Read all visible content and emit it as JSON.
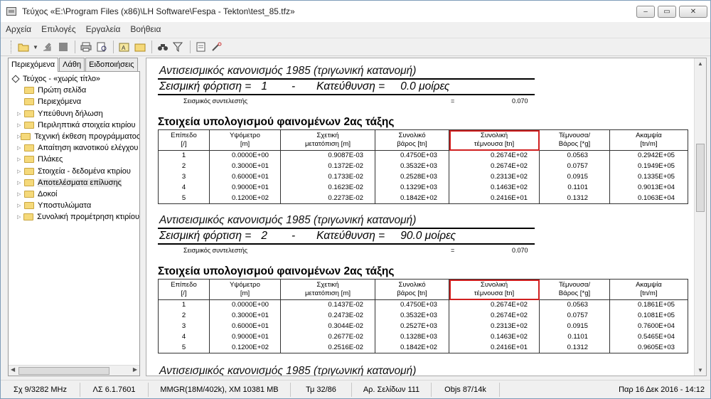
{
  "window": {
    "title": "Τεύχος «E:\\Program Files (x86)\\LH Software\\Fespa - Tekton\\test_85.tfz»",
    "minimize": "–",
    "maximize": "▭",
    "close": "✕"
  },
  "menu": [
    "Αρχεία",
    "Επιλογές",
    "Εργαλεία",
    "Βοήθεια"
  ],
  "left_tabs": [
    "Περιεχόμενα",
    "Λάθη",
    "Ειδοποιήσεις"
  ],
  "tree": {
    "root": "Τεύχος - «χωρίς τίτλο»",
    "items": [
      {
        "label": "Πρώτη σελίδα",
        "arrow": ""
      },
      {
        "label": "Περιεχόμενα",
        "arrow": ""
      },
      {
        "label": "Υπεύθυνη δήλωση",
        "arrow": "▷"
      },
      {
        "label": "Περιληπτικά στοιχεία κτιρίου",
        "arrow": "▷"
      },
      {
        "label": "Τεχνική έκθεση προγράμματος",
        "arrow": "▷"
      },
      {
        "label": "Απαίτηση ικανοτικού ελέγχου",
        "arrow": "▷"
      },
      {
        "label": "Πλάκες",
        "arrow": "▷"
      },
      {
        "label": "Στοιχεία - δεδομένα κτιρίου",
        "arrow": "▷"
      },
      {
        "label": "Αποτελέσματα επίλυσης",
        "arrow": "▷"
      },
      {
        "label": "Δοκοί",
        "arrow": "▷"
      },
      {
        "label": "Υποστυλώματα",
        "arrow": "▷"
      },
      {
        "label": "Συνολική προμέτρηση κτιρίου",
        "arrow": "▷"
      }
    ]
  },
  "document": {
    "norm_title": "Αντισεισμικός κανονισμός 1985 (τριγωνική κατανομή)",
    "coef_label": "Σεισμικός συντελεστής",
    "coef_eq": "=",
    "section_title": "Στοιχεία υπολογισμού φαινομένων 2ας τάξης",
    "headers": [
      [
        "Επίπεδο",
        "[/]"
      ],
      [
        "Υψόμετρο",
        "[m]"
      ],
      [
        "Σχετική",
        "μετατόπιση [m]"
      ],
      [
        "Συνολικό",
        "βάρος [tn]"
      ],
      [
        "Συνολική",
        "τέμνουσα [tn]"
      ],
      [
        "Τέμνουσα/",
        "Βάρος [*g]"
      ],
      [
        "Ακαμψία",
        "[tn/m]"
      ]
    ],
    "blocks": [
      {
        "load_label": "Σεισμική φόρτιση =",
        "load_num": "1",
        "dash": "-",
        "dir_label": "Κατεύθυνση =",
        "dir_value": "0.0 μοίρες",
        "coef_value": "0.070",
        "rows": [
          [
            "1",
            "0.0000E+00",
            "0.9087E-03",
            "0.4750E+03",
            "0.2674E+02",
            "0.0563",
            "0.2942E+05"
          ],
          [
            "2",
            "0.3000E+01",
            "0.1372E-02",
            "0.3532E+03",
            "0.2674E+02",
            "0.0757",
            "0.1949E+05"
          ],
          [
            "3",
            "0.6000E+01",
            "0.1733E-02",
            "0.2528E+03",
            "0.2313E+02",
            "0.0915",
            "0.1335E+05"
          ],
          [
            "4",
            "0.9000E+01",
            "0.1623E-02",
            "0.1329E+03",
            "0.1463E+02",
            "0.1101",
            "0.9013E+04"
          ],
          [
            "5",
            "0.1200E+02",
            "0.2273E-02",
            "0.1842E+02",
            "0.2416E+01",
            "0.1312",
            "0.1063E+04"
          ]
        ]
      },
      {
        "load_label": "Σεισμική φόρτιση =",
        "load_num": "2",
        "dash": "-",
        "dir_label": "Κατεύθυνση =",
        "dir_value": "90.0 μοίρες",
        "coef_value": "0.070",
        "rows": [
          [
            "1",
            "0.0000E+00",
            "0.1437E-02",
            "0.4750E+03",
            "0.2674E+02",
            "0.0563",
            "0.1861E+05"
          ],
          [
            "2",
            "0.3000E+01",
            "0.2473E-02",
            "0.3532E+03",
            "0.2674E+02",
            "0.0757",
            "0.1081E+05"
          ],
          [
            "3",
            "0.6000E+01",
            "0.3044E-02",
            "0.2527E+03",
            "0.2313E+02",
            "0.0915",
            "0.7600E+04"
          ],
          [
            "4",
            "0.9000E+01",
            "0.2677E-02",
            "0.1328E+03",
            "0.1463E+02",
            "0.1101",
            "0.5465E+04"
          ],
          [
            "5",
            "0.1200E+02",
            "0.2516E-02",
            "0.1842E+02",
            "0.2416E+01",
            "0.1312",
            "0.9605E+03"
          ]
        ]
      }
    ]
  },
  "status": [
    "Σχ 9/3282 MHz",
    "ΛΣ 6.1.7601",
    "MMGR(18M/402k), XM 10381 MB",
    "Τμ 32/86",
    "Αρ. Σελίδων 111",
    "Objs 87/14k",
    "Παρ 16 Δεκ 2016 - 14:12"
  ],
  "colors": {
    "highlight": "#d02020",
    "folder": "#f5d97a"
  }
}
